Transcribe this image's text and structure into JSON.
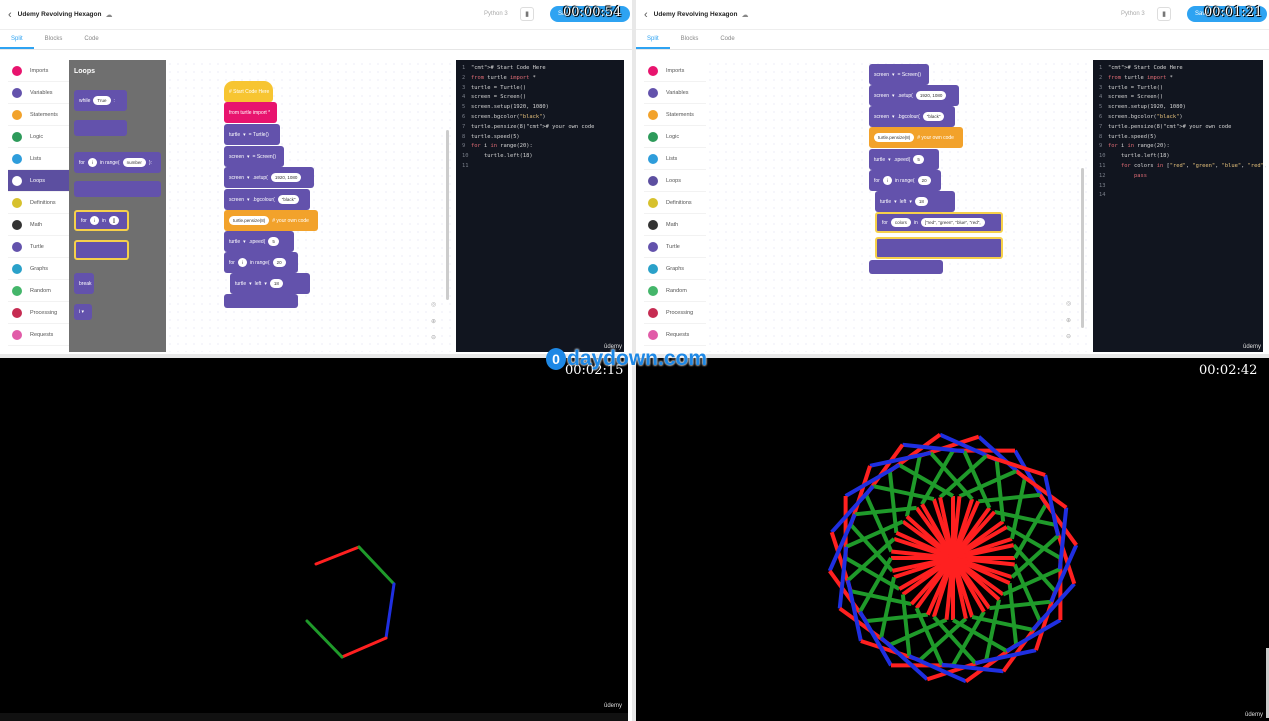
{
  "brand_color": "#2ea3f2",
  "q1": {
    "timer": "00:00:54",
    "title": "Udemy Revolving Hexagon",
    "python": "Python 3",
    "save": "Save",
    "tabs": [
      "Split",
      "Blocks",
      "Code"
    ],
    "sidebar": [
      "Imports",
      "Variables",
      "Statements",
      "Logic",
      "Lists",
      "Loops",
      "Definitions",
      "Math",
      "Turtle",
      "Graphs",
      "Random",
      "Processing",
      "Requests"
    ],
    "sidebar_colors": [
      "#e8146e",
      "#6352ac",
      "#f2a22b",
      "#2d9a5a",
      "#2e9ddb",
      "#5c4fa0",
      "#d7c12d",
      "#333",
      "#6352ac",
      "#2aa1c9",
      "#44b66a",
      "#c62c52",
      "#e15ba8"
    ],
    "flyout": {
      "title": "Loops",
      "while": "while",
      "while_val": "True",
      "for": "for",
      "for_var": "i",
      "in_range": "in range(",
      "number": "number",
      "close": "):",
      "for2": "for",
      "for2_var": "i",
      "in": "in",
      "for2_list": "[]",
      "break": "break"
    },
    "blocks": {
      "start": "# Start Code Here",
      "import": "from turtle import *",
      "b1_var": "turtle",
      "b1_eq": "= Turtle()",
      "b2_var": "screen",
      "b2_eq": "= Screen()",
      "b3_var": "screen",
      "b3_fn": ".setup(",
      "b3_arg": "1920, 1080",
      "b4_var": "screen",
      "b4_fn": ".bgcolour(",
      "b4_arg": "\"black\"",
      "b5_fn": "turtle.pensize(8)",
      "b5_cmt": "# your own code",
      "b6_var": "turtle",
      "b6_fn": ".speed(",
      "b6_arg": "5",
      "b7_for": "for",
      "b7_var": "i",
      "b7_range": "in range(",
      "b7_arg": "20",
      "b8_var": "turtle",
      "b8_fn": "left",
      "b8_arg": "18"
    },
    "code": [
      "# Start Code Here",
      "from turtle import *",
      "turtle = Turtle()",
      "screen = Screen()",
      "screen.setup(1920, 1080)",
      "screen.bgcolor(\"black\")",
      "turtle.pensize(8)# your own code",
      "turtle.speed(5)",
      "for i in range(20):",
      "    turtle.left(18)",
      ""
    ],
    "watermark": "ûdemy"
  },
  "q2": {
    "timer": "00:01:21",
    "title": "Udemy Revolving Hexagon",
    "python": "Python 3",
    "save": "Save",
    "tabs": [
      "Split",
      "Blocks",
      "Code"
    ],
    "sidebar": [
      "Imports",
      "Variables",
      "Statements",
      "Logic",
      "Lists",
      "Loops",
      "Definitions",
      "Math",
      "Turtle",
      "Graphs",
      "Random",
      "Processing",
      "Requests"
    ],
    "blocks": {
      "b1_var": "screen",
      "b1_eq": "= Screen()",
      "b2_var": "screen",
      "b2_fn": ".setup(",
      "b2_arg": "1920, 1080",
      "b3_var": "screen",
      "b3_fn": ".bgcolour(",
      "b3_arg": "\"black\"",
      "b4_fn": "turtle.pensize(8)",
      "b4_cmt": "# your own code",
      "b5_var": "turtle",
      "b5_fn": ".speed(",
      "b5_arg": "5",
      "b6_for": "for",
      "b6_var": "i",
      "b6_range": "in range(",
      "b6_arg": "20",
      "b7_var": "turtle",
      "b7_fn": "left",
      "b7_arg": "18",
      "b8_for": "for",
      "b8_var": "colors",
      "b8_in": "in",
      "b8_list": "[\"red\", \"green\", \"blue\", \"red\","
    },
    "code": [
      "# Start Code Here",
      "from turtle import *",
      "turtle = Turtle()",
      "screen = Screen()",
      "screen.setup(1920, 1080)",
      "screen.bgcolor(\"black\")",
      "turtle.pensize(8)# your own code",
      "turtle.speed(5)",
      "for i in range(20):",
      "    turtle.left(18)",
      "    for colors in [\"red\", \"green\", \"blue\", \"red\", :",
      "        pass",
      "",
      ""
    ],
    "watermark": "ûdemy"
  },
  "q3": {
    "timer": "00:02:15",
    "watermark": "ûdemy"
  },
  "q4": {
    "timer": "00:02:42",
    "watermark": "ûdemy"
  },
  "logo": {
    "mark": "0",
    "text": "daydown.com"
  },
  "drawing_colors": {
    "red": "#ff2020",
    "green": "#1f9a2a",
    "blue": "#1f2fe0"
  }
}
